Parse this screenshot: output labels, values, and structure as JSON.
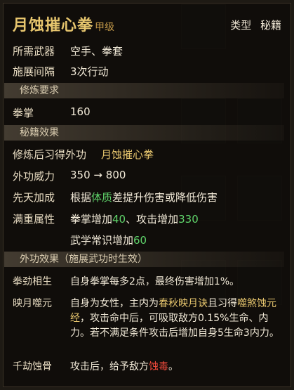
{
  "item": {
    "name": "月蚀摧心拳",
    "grade": "甲级",
    "type_label": "类型",
    "type_value": "秘籍"
  },
  "info": {
    "weapon_label": "所需武器",
    "weapon_value": "空手、拳套",
    "interval_label": "施展间隔",
    "interval_value": "3次行动"
  },
  "sections": {
    "requirements": "修炼要求",
    "effects": "秘籍效果",
    "external": "外功效果（施展武功时生效）"
  },
  "requirements": {
    "label": "拳掌",
    "value": "160"
  },
  "effects": {
    "learn_label": "修炼后习得外功",
    "learn_value": "月蚀摧心拳",
    "power_label": "外功威力",
    "power_from": "350",
    "power_arrow": "→",
    "power_to": "800",
    "innate_label": "先天加成",
    "innate_pre": "根据",
    "innate_highlight": "体质",
    "innate_post": "差提升伤害或降低伤害",
    "full_label": "满重属性",
    "full_a_pre": "拳掌增加",
    "full_a_val": "40",
    "full_a_mid": "、攻击增加",
    "full_a_val2": "330",
    "full_b_pre": "武学常识增加",
    "full_b_val": "60"
  },
  "external": {
    "e1_label": "拳劲相生",
    "e1_text": "自身拳掌每多2点，最终伤害增加1%。",
    "e2_label": "映月噬元",
    "e2_t1": "自身为女性，主内为",
    "e2_h1": "春秋映月诀",
    "e2_t2": "且习得",
    "e2_h2": "噬煞蚀元经",
    "e2_t3": "，攻击命中后，可吸取敌方0.15%生命、内力。若不满足条件攻击后增加自身5生命3内力。",
    "e3_label": "千劫蚀骨",
    "e3_t1": "攻击后，给予敌方",
    "e3_h1": "蚀毒",
    "e3_t2": "。"
  },
  "colors": {
    "title": "#e7c66e",
    "highlight_yellow": "#e7c66e",
    "highlight_green": "#5fd36a",
    "highlight_red": "#f24a3c"
  }
}
